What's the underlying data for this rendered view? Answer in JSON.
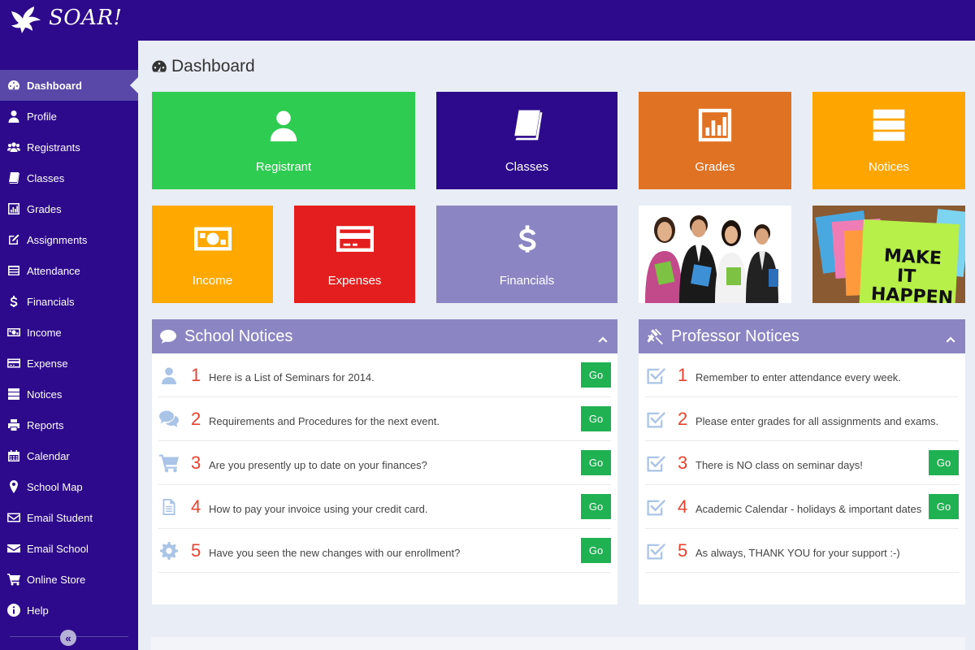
{
  "app": {
    "logo_text": "SOAR!"
  },
  "sidebar": {
    "items": [
      {
        "label": "Dashboard",
        "icon": "dashboard-icon",
        "active": true
      },
      {
        "label": "Profile",
        "icon": "user-icon"
      },
      {
        "label": "Registrants",
        "icon": "users-icon"
      },
      {
        "label": "Classes",
        "icon": "book-icon"
      },
      {
        "label": "Grades",
        "icon": "bar-chart-icon"
      },
      {
        "label": "Assignments",
        "icon": "edit-icon"
      },
      {
        "label": "Attendance",
        "icon": "list-icon"
      },
      {
        "label": "Financials",
        "icon": "dollar-icon"
      },
      {
        "label": "Income",
        "icon": "money-icon"
      },
      {
        "label": "Expense",
        "icon": "credit-card-icon"
      },
      {
        "label": "Notices",
        "icon": "tasks-icon"
      },
      {
        "label": "Reports",
        "icon": "print-icon"
      },
      {
        "label": "Calendar",
        "icon": "calendar-icon"
      },
      {
        "label": "School Map",
        "icon": "map-marker-icon"
      },
      {
        "label": "Email Student",
        "icon": "envelope-o-icon"
      },
      {
        "label": "Email School",
        "icon": "envelope-icon"
      },
      {
        "label": "Online Store",
        "icon": "cart-icon"
      },
      {
        "label": "Help",
        "icon": "info-icon"
      }
    ],
    "collapse_glyph": "«"
  },
  "main": {
    "title": "Dashboard",
    "tiles": [
      {
        "label": "Registrant",
        "color": "#2ecc51",
        "icon": "user-icon"
      },
      {
        "label": "Classes",
        "color": "#2d0a8c",
        "icon": "book-icon"
      },
      {
        "label": "Grades",
        "color": "#e07224",
        "icon": "bar-chart-icon"
      },
      {
        "label": "Notices",
        "color": "#ffa500",
        "icon": "tasks-icon"
      },
      {
        "label": "Income",
        "color": "#ffa800",
        "icon": "money-icon"
      },
      {
        "label": "Expenses",
        "color": "#e41e1e",
        "icon": "credit-card-icon"
      },
      {
        "label": "Financials",
        "color": "#8b86c3",
        "icon": "dollar-icon"
      }
    ],
    "photos": [
      {
        "name": "students-photo"
      },
      {
        "name": "sticky-notes-photo",
        "text": [
          "MAKE",
          "IT",
          "HAPPEN"
        ]
      }
    ]
  },
  "school_notices": {
    "title": "School Notices",
    "header_color": "#8b86c3",
    "items": [
      {
        "num": "1",
        "text": "Here is a List of Seminars for 2014.",
        "icon": "user-icon",
        "go": "Go"
      },
      {
        "num": "2",
        "text": "Requirements and Procedures for the next event.",
        "icon": "comments-icon",
        "go": "Go"
      },
      {
        "num": "3",
        "text": "Are you presently up to date on your finances?",
        "icon": "cart-icon",
        "go": "Go"
      },
      {
        "num": "4",
        "text": "How to pay your invoice using your credit card.",
        "icon": "file-icon",
        "go": "Go"
      },
      {
        "num": "5",
        "text": "Have you seen the new changes with our enrollment?",
        "icon": "gear-icon",
        "go": "Go"
      }
    ]
  },
  "professor_notices": {
    "title": "Professor Notices",
    "items": [
      {
        "num": "1",
        "text": "Remember to enter attendance every week.",
        "icon": "check-square-icon"
      },
      {
        "num": "2",
        "text": "Please enter grades for all assignments and exams.",
        "icon": "check-square-icon"
      },
      {
        "num": "3",
        "text": "There is NO class on seminar days!",
        "icon": "check-square-icon",
        "go": "Go"
      },
      {
        "num": "4",
        "text": "Academic Calendar - holidays & important dates",
        "icon": "check-square-icon",
        "go": "Go"
      },
      {
        "num": "5",
        "text": "As always, THANK YOU for your support :-)",
        "icon": "check-square-icon"
      }
    ]
  }
}
